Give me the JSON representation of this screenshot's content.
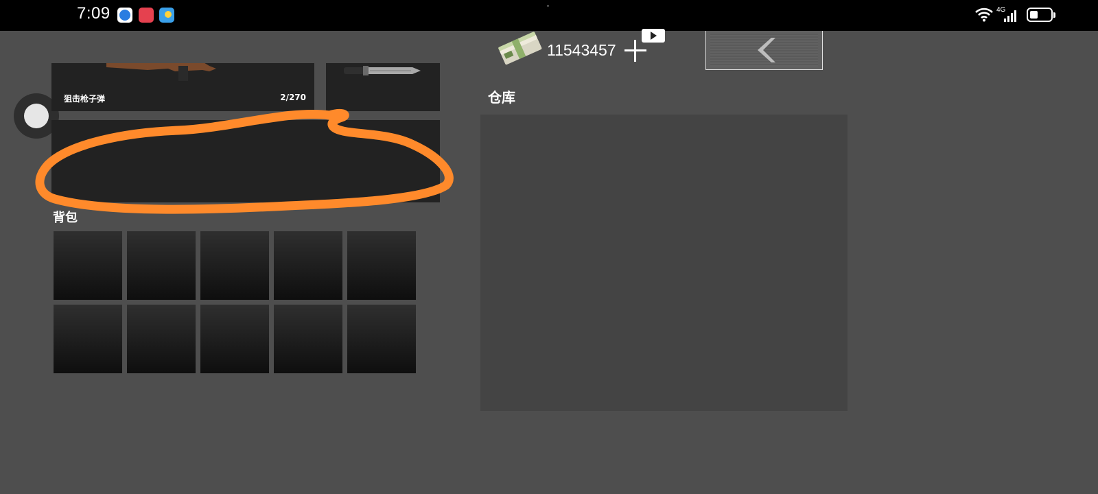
{
  "status_bar": {
    "time": "7:09",
    "network": "4G",
    "icons": [
      "browser-app-icon",
      "app-icon",
      "weather-app-icon",
      "wifi-icon",
      "signal-icon",
      "battery-icon"
    ]
  },
  "equipment": {
    "primary": {
      "name": "狙击枪子弹",
      "ammo": "2/270",
      "icon": "sniper-rifle-icon"
    },
    "melee": {
      "icon": "bayonet-knife-icon"
    },
    "annotation_color": "#ff8a2b"
  },
  "backpack": {
    "title": "背包",
    "slots": [
      {},
      {},
      {},
      {},
      {},
      {},
      {},
      {},
      {},
      {}
    ]
  },
  "currency": {
    "amount": "11543457",
    "icon": "cash-stack-icon"
  },
  "warehouse": {
    "title": "仓库"
  },
  "colors": {
    "background": "#4e4e4e",
    "slot": "#222222",
    "warehouse_panel": "#444444"
  }
}
